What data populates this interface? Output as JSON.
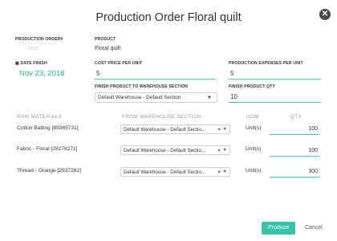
{
  "dialog": {
    "title": "Production Order Floral quilt",
    "close_icon": "close-circle-icon"
  },
  "order": {
    "production_order_label": "PRODUCTION ORDER#",
    "production_order_value": "New",
    "product_label": "PRODUCT",
    "product_value": "Floral quilt",
    "date_finish_label": "DATE FINISH",
    "date_finish_icon": "calendar-icon",
    "date_finish_value": "Nov 23, 2018",
    "cost_price_label": "COST PRICE PER UNIT",
    "cost_price_value": "5",
    "production_expenses_label": "PRODUCTION EXPENSES PER UNIT",
    "production_expenses_value": "5",
    "finish_warehouse_label": "FINISH PRODUCT TO WAREHOUSE SECTION",
    "finish_warehouse_value": "Default Warehouse - Default Section",
    "finish_qty_label": "FINISH PRODUCT QTY",
    "finish_qty_value": "10"
  },
  "materials": {
    "headers": {
      "raw": "RAW MATERIALS",
      "from": "FROM WAREHOUSE SECTION",
      "uom": "UOM",
      "qty": "QTY"
    },
    "rows": [
      {
        "name": "Cotton Batting [89365731]",
        "section": "Default Warehouse - Default Sectio...",
        "uom": "Unit(s)",
        "qty": "100"
      },
      {
        "name": "Fabric - Floral [28278271]",
        "section": "Default Warehouse - Default Sectio...",
        "uom": "Unit(s)",
        "qty": "100"
      },
      {
        "name": "Thread - Orange [2837262]",
        "section": "Default Warehouse - Default Sectio...",
        "uom": "Unit(s)",
        "qty": "300"
      }
    ]
  },
  "footer": {
    "produce_label": "Produce",
    "cancel_label": "Cancel"
  },
  "colors": {
    "accent": "#38c2a9",
    "date_text": "#2cb5a0"
  }
}
